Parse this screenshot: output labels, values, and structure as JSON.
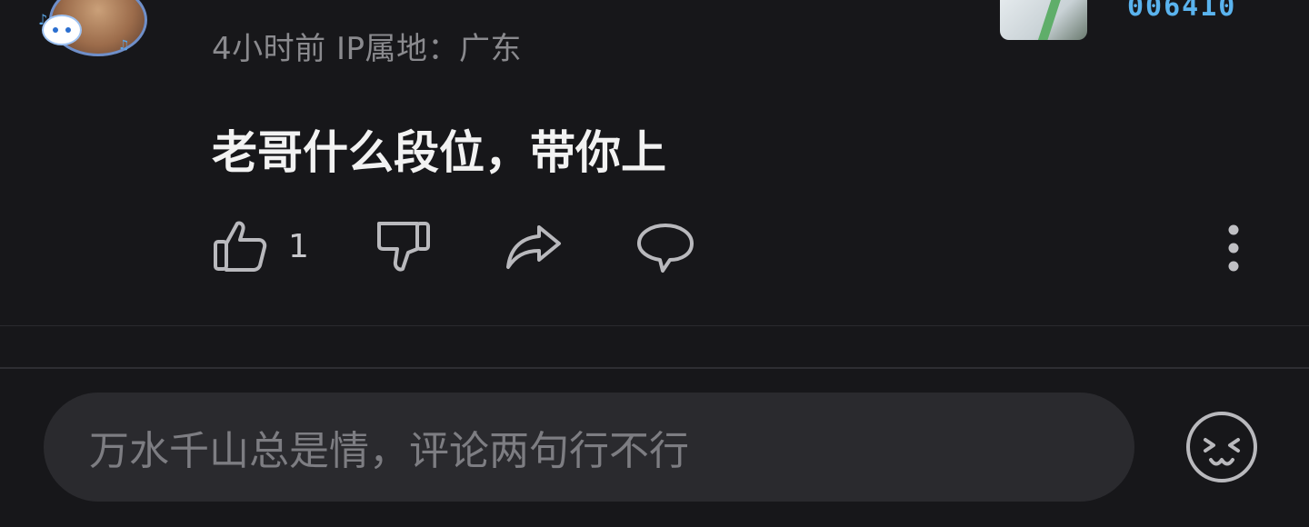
{
  "comment": {
    "meta": "4小时前 IP属地：广东",
    "text": "老哥什么段位，带你上",
    "like_count": "1",
    "fan_badge_number": "006410"
  },
  "actions": {
    "like_icon": "thumbs-up-icon",
    "dislike_icon": "thumbs-down-icon",
    "share_icon": "share-arrow-icon",
    "reply_icon": "speech-bubble-icon",
    "more_icon": "vertical-ellipsis-icon"
  },
  "composer": {
    "placeholder": "万水千山总是情，评论两句行不行",
    "emoji_icon": "emoji-face-icon"
  },
  "colors": {
    "background": "#17171a",
    "text_primary": "#f2f2f2",
    "text_secondary": "#8a8a8e",
    "accent_number": "#5ab3ee",
    "input_bg": "#2a2a2e"
  }
}
